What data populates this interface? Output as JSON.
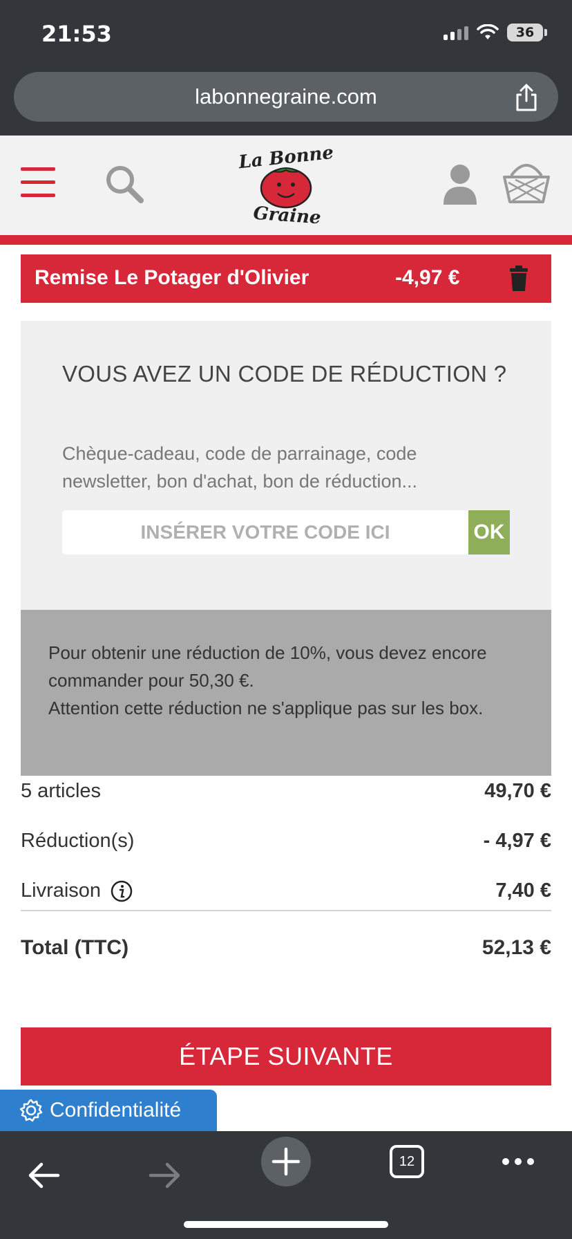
{
  "status_bar": {
    "time": "21:53",
    "battery": "36"
  },
  "browser": {
    "url": "labonnegraine.com",
    "tab_count": "12"
  },
  "header": {
    "logo_text_top": "La Bonne",
    "logo_text_bottom": "Graine"
  },
  "discount": {
    "label": "Remise Le Potager d'Olivier",
    "amount": "-4,97 €"
  },
  "promo": {
    "title": "VOUS AVEZ UN CODE DE RÉDUCTION ?",
    "description": "Chèque-cadeau, code de parrainage, code newsletter, bon d'achat, bon de réduction...",
    "input_placeholder": "INSÉRER VOTRE CODE ICI",
    "input_value": "",
    "ok_label": "OK"
  },
  "info": {
    "line1": "Pour obtenir une réduction de 10%, vous devez encore commander pour 50,30 €.",
    "line2": "Attention cette réduction ne s'applique pas sur les box."
  },
  "summary": {
    "articles_label": "5 articles",
    "articles_value": "49,70 €",
    "reductions_label": "Réduction(s)",
    "reductions_value": "- 4,97 €",
    "delivery_label": "Livraison",
    "delivery_value": "7,40 €",
    "total_label": "Total (TTC)",
    "total_value": "52,13 €"
  },
  "actions": {
    "next_step": "ÉTAPE SUIVANTE",
    "privacy": "Confidentialité"
  },
  "colors": {
    "brand_red": "#d7283a",
    "ok_green": "#8fae5a",
    "privacy_blue": "#2f7fcf",
    "chrome_dark": "#33373b"
  },
  "icons": [
    "menu-icon",
    "search-icon",
    "user-icon",
    "basket-icon",
    "trash-icon",
    "info-icon",
    "gear-icon",
    "back-icon",
    "forward-icon",
    "plus-icon",
    "tabs-icon",
    "more-icon",
    "share-icon"
  ]
}
